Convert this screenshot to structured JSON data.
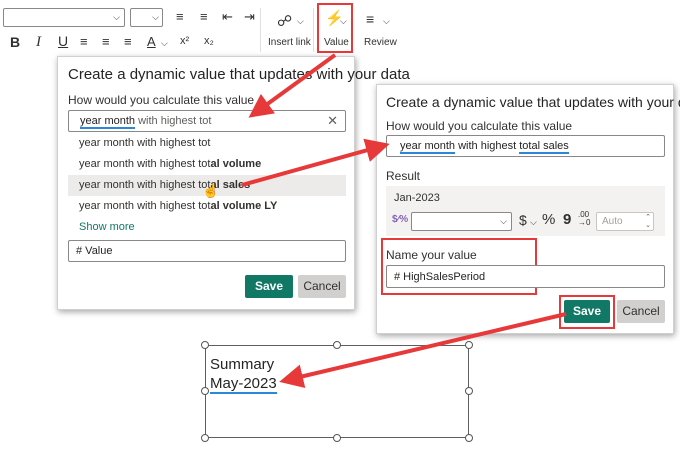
{
  "toolbar": {
    "bold": "B",
    "italic": "I",
    "underline": "U",
    "font_color": "A",
    "superscript": "x²",
    "subscript": "x₂",
    "insert_link_label": "Insert link",
    "value_label": "Value",
    "review_label": "Review"
  },
  "left_panel": {
    "title": "Create a dynamic value that updates with your data",
    "question_label": "How would you calculate this value",
    "query": {
      "highlight": "year month",
      "rest": " with highest tot"
    },
    "suggestions": [
      {
        "plain": "year month with highest tot",
        "bold": ""
      },
      {
        "plain": "year month with highest tot",
        "bold": "al volume"
      },
      {
        "plain": "year month with highest tot",
        "bold": "al sales"
      },
      {
        "plain": "year month with highest tot",
        "bold": "al volume LY"
      }
    ],
    "show_more": "Show more",
    "name_value": "# Value",
    "save_label": "Save",
    "cancel_label": "Cancel"
  },
  "right_panel": {
    "title": "Create a dynamic value that updates with your data",
    "question_label": "How would you calculate this value",
    "query": {
      "hl1": "year month",
      "mid": " with highest ",
      "hl2": "total sales"
    },
    "result_label": "Result",
    "result_value": "Jan-2023",
    "format_icon": "$⁄%",
    "currency": "$",
    "percent": "%",
    "comma": "9",
    "decimal_top": ".00",
    "decimal_bottom": "→0",
    "auto_placeholder": "Auto",
    "name_label": "Name your value",
    "name_value": "# HighSalesPeriod",
    "save_label": "Save",
    "cancel_label": "Cancel"
  },
  "textbox": {
    "line1": "Summary",
    "line2": "May-2023"
  },
  "colors": {
    "accent": "#117865",
    "callout": "#e8393a",
    "highlight_underline": "#2b88d8"
  }
}
